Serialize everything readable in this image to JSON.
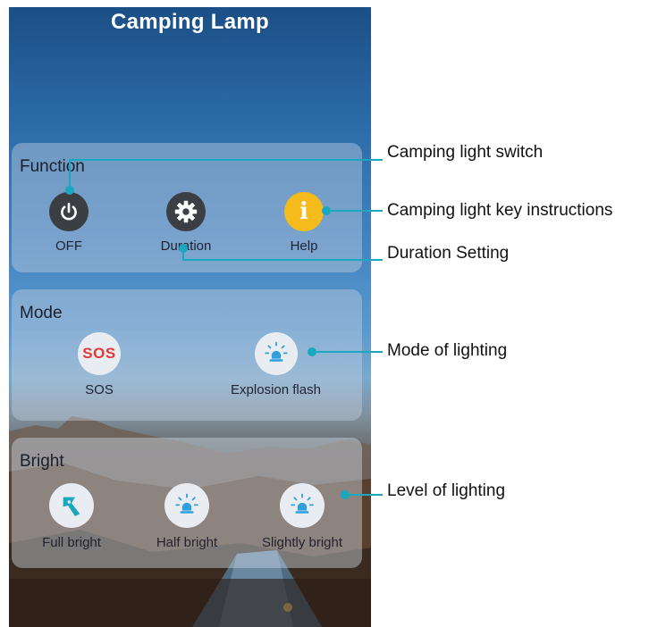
{
  "app": {
    "title": "Camping Lamp"
  },
  "function_panel": {
    "title": "Function",
    "buttons": [
      {
        "label": "OFF",
        "icon": "power-icon"
      },
      {
        "label": "Duration",
        "icon": "gear-icon"
      },
      {
        "label": "Help",
        "icon": "info-icon",
        "glyph": "i"
      }
    ]
  },
  "mode_panel": {
    "title": "Mode",
    "buttons": [
      {
        "label": "SOS",
        "icon": "sos-icon",
        "glyph": "SOS"
      },
      {
        "label": "Explosion flash",
        "icon": "bulb-icon"
      }
    ]
  },
  "bright_panel": {
    "title": "Bright",
    "buttons": [
      {
        "label": "Full bright",
        "icon": "flashlight-icon"
      },
      {
        "label": "Half bright",
        "icon": "bulb-icon"
      },
      {
        "label": "Slightly bright",
        "icon": "bulb-icon"
      }
    ]
  },
  "callouts": [
    {
      "text": "Camping light switch"
    },
    {
      "text": "Camping light key instructions"
    },
    {
      "text": "Duration Setting"
    },
    {
      "text": "Mode of lighting"
    },
    {
      "text": "Level of lighting"
    }
  ],
  "colors": {
    "accent": "#1aa8be",
    "help": "#f5bb1c",
    "sos": "#e1373a",
    "dark_button": "#3b3e43",
    "bulb": "#2f9fe0"
  }
}
